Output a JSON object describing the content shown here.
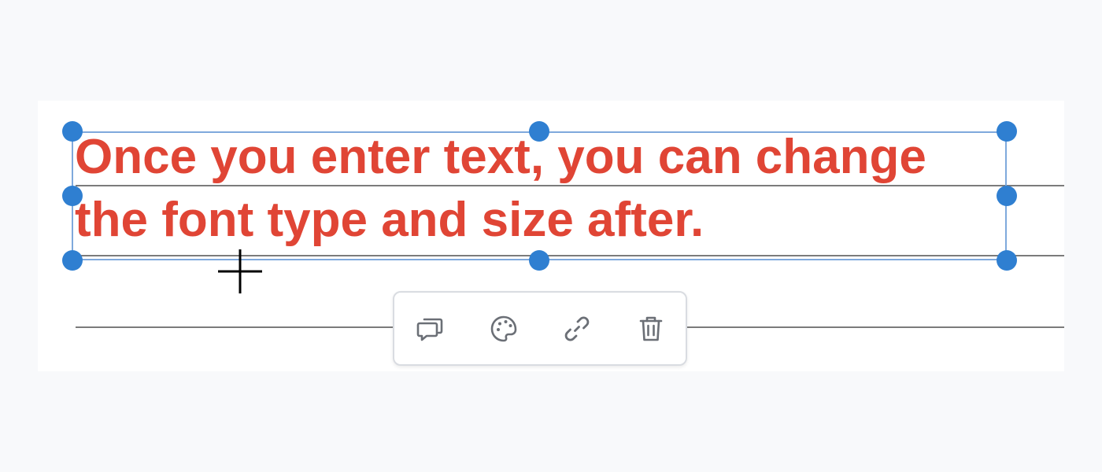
{
  "annotation": {
    "text": "Once you enter text, you can change the font type and size after.",
    "color": "#e04535"
  },
  "selection": {
    "border_color": "#7fa9dc",
    "handle_color": "#2f7fd1"
  },
  "toolbar": {
    "items": [
      {
        "icon": "comment-icon"
      },
      {
        "icon": "palette-icon"
      },
      {
        "icon": "link-icon"
      },
      {
        "icon": "trash-icon"
      }
    ]
  }
}
